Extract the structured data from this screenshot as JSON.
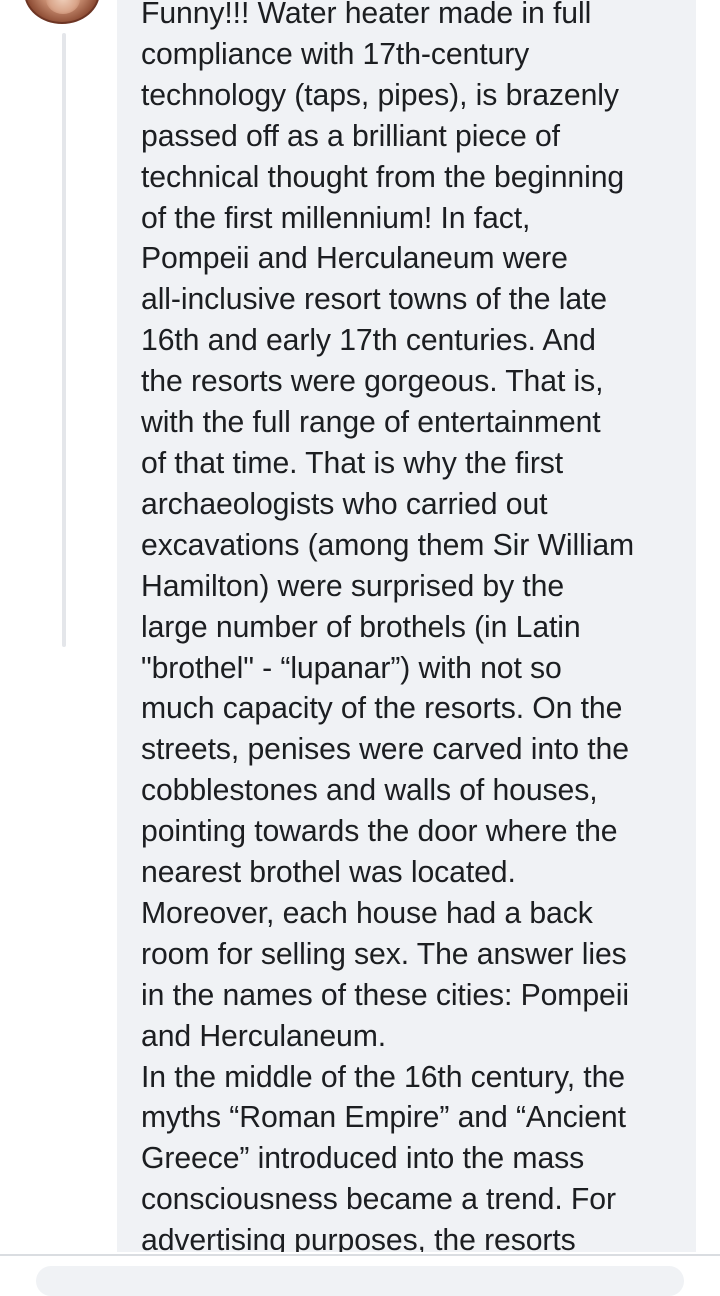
{
  "avatar": {
    "icon": "user-avatar"
  },
  "comment": {
    "text": "Funny!!!  Water heater made in full\ncompliance with 17th-century\ntechnology (taps, pipes), is brazenly\npassed off as a brilliant piece of\ntechnical thought from the beginning\nof the first millennium! In fact,\nPompeii and Herculaneum were\nall-inclusive resort towns of the late\n16th and early 17th centuries. And\nthe resorts were gorgeous. That is,\nwith the full range of entertainment\nof that time. That is why the first\narchaeologists who carried out\nexcavations (among them Sir William\nHamilton) were surprised by the\nlarge number of brothels (in Latin\n\"brothel\" - “lupanar”) with not so\nmuch capacity of the resorts. On the\nstreets, penises were carved into the\ncobblestones and walls of houses,\npointing towards the door where the\nnearest brothel was located.\nMoreover, each house had a back\nroom for selling sex. The answer lies\nin the names of these cities: Pompeii\nand Herculaneum.\nIn the middle of the 16th century, the\nmyths “Roman Empire” and “Ancient\nGreece” introduced into the mass\nconsciousness became a trend. For\nadvertising purposes, the resorts"
  },
  "colors": {
    "bubble_background": "#f0f2f5",
    "text": "#1c1e21",
    "thread_line": "#e4e6ea"
  }
}
